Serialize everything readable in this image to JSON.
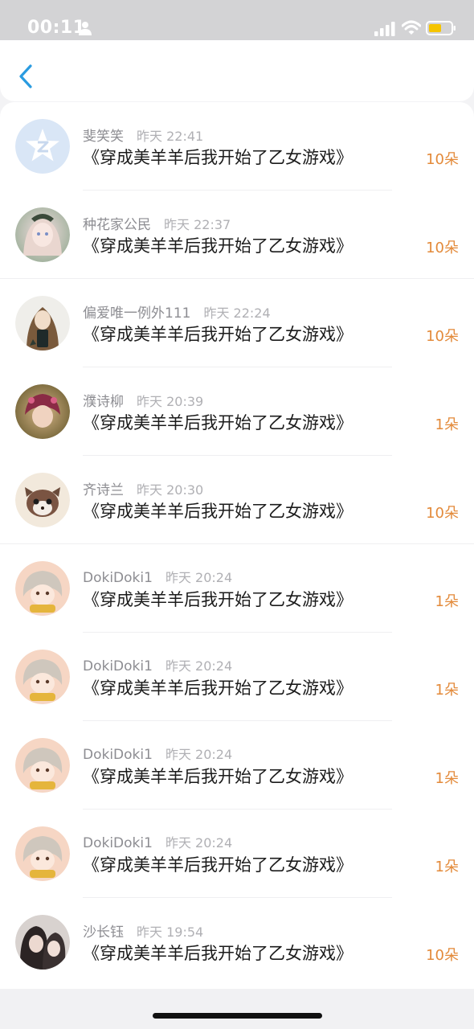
{
  "status_bar": {
    "time": "00:11"
  },
  "list": [
    {
      "name": "斐笑笑",
      "time": "昨天 22:41",
      "title": "《穿成美羊羊后我开始了乙女游戏》",
      "count": "10朵",
      "avatar": "qq-logo-avatar"
    },
    {
      "name": "种花家公民",
      "time": "昨天 22:37",
      "title": "《穿成美羊羊后我开始了乙女游戏》",
      "count": "10朵",
      "avatar": "anime-girl-avatar"
    },
    {
      "name": "偏爱唯一例外111",
      "time": "昨天 22:24",
      "title": "《穿成美羊羊后我开始了乙女游戏》",
      "count": "10朵",
      "avatar": "girl-photo-avatar"
    },
    {
      "name": "濮诗柳",
      "time": "昨天 20:39",
      "title": "《穿成美羊羊后我开始了乙女游戏》",
      "count": "1朵",
      "avatar": "doll-avatar"
    },
    {
      "name": "齐诗兰",
      "time": "昨天 20:30",
      "title": "《穿成美羊羊后我开始了乙女游戏》",
      "count": "10朵",
      "avatar": "raccoon-avatar"
    },
    {
      "name": "DokiDoki1",
      "time": "昨天 20:24",
      "title": "《穿成美羊羊后我开始了乙女游戏》",
      "count": "1朵",
      "avatar": "anime-sheep-avatar"
    },
    {
      "name": "DokiDoki1",
      "time": "昨天 20:24",
      "title": "《穿成美羊羊后我开始了乙女游戏》",
      "count": "1朵",
      "avatar": "anime-sheep-avatar"
    },
    {
      "name": "DokiDoki1",
      "time": "昨天 20:24",
      "title": "《穿成美羊羊后我开始了乙女游戏》",
      "count": "1朵",
      "avatar": "anime-sheep-avatar"
    },
    {
      "name": "DokiDoki1",
      "time": "昨天 20:24",
      "title": "《穿成美羊羊后我开始了乙女游戏》",
      "count": "1朵",
      "avatar": "anime-sheep-avatar"
    },
    {
      "name": "沙长钰",
      "time": "昨天 19:54",
      "title": "《穿成美羊羊后我开始了乙女游戏》",
      "count": "10朵",
      "avatar": "couple-photo-avatar"
    }
  ]
}
